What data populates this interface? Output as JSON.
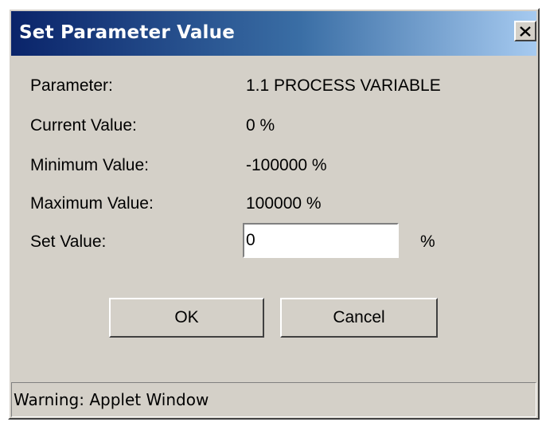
{
  "window": {
    "title": "Set Parameter Value",
    "close_icon": "close-icon"
  },
  "fields": [
    {
      "label": "Parameter:",
      "value": "1.1 PROCESS VARIABLE"
    },
    {
      "label": "Current Value:",
      "value": "0 %"
    },
    {
      "label": "Minimum Value:",
      "value": "-100000 %"
    },
    {
      "label": "Maximum Value:",
      "value": "100000 %"
    }
  ],
  "set_value": {
    "label": "Set Value:",
    "value": "0",
    "unit": "%"
  },
  "buttons": {
    "ok_label": "OK",
    "cancel_label": "Cancel"
  },
  "status": {
    "warning": "Warning: Applet Window"
  },
  "colors": {
    "title_start": "#0a246a",
    "title_end": "#a6caf0",
    "face": "#d4d0c8"
  }
}
